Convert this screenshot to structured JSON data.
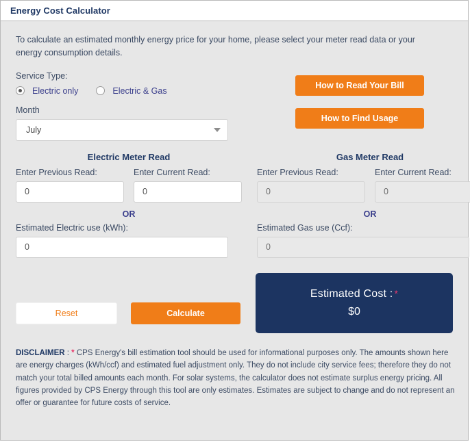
{
  "window": {
    "title": "Energy Cost Calculator"
  },
  "intro": {
    "text": "To calculate an estimated monthly energy price for your home, please select your meter read data or your energy consumption details."
  },
  "service_type": {
    "label": "Service Type:",
    "options": [
      {
        "label": "Electric only",
        "selected": true
      },
      {
        "label": "Electric & Gas",
        "selected": false
      }
    ]
  },
  "month": {
    "label": "Month",
    "value": "July",
    "caret_icon": "chevron-down-icon"
  },
  "help_buttons": {
    "read_bill": "How to Read Your Bill",
    "find_usage": "How to Find Usage"
  },
  "electric_meter": {
    "title": "Electric Meter Read",
    "previous_label": "Enter Previous Read:",
    "previous_value": "0",
    "current_label": "Enter Current Read:",
    "current_value": "0",
    "or": "OR",
    "estimated_label": "Estimated Electric use (kWh):",
    "estimated_value": "0"
  },
  "gas_meter": {
    "title": "Gas Meter Read",
    "previous_label": "Enter Previous Read:",
    "previous_value": "0",
    "current_label": "Enter Current Read:",
    "current_value": "0",
    "or": "OR",
    "estimated_label": "Estimated Gas use (Ccf):",
    "estimated_value": "0"
  },
  "actions": {
    "reset": "Reset",
    "calculate": "Calculate"
  },
  "estimated_cost": {
    "title": "Estimated Cost :",
    "star": "*",
    "value": "$0"
  },
  "disclaimer": {
    "heading": "DISCLAIMER",
    "separator": " : ",
    "star": "*",
    "text": " CPS Energy's bill estimation tool should be used for informational purposes only. The amounts shown here are energy charges (kWh/ccf) and estimated fuel adjustment only. They do not include city service fees; therefore they do not match your total billed amounts each month. For solar systems, the calculator does not estimate surplus energy pricing. All figures provided by CPS Energy through this tool are only estimates. Estimates are subject to change and do not represent an offer or guarantee for future costs of service."
  },
  "colors": {
    "accent_orange": "#f07d18",
    "navy": "#1c3461",
    "heading_navy": "#1f3864",
    "label_blue": "#3b4a63",
    "radio_blue": "#3b3f8c",
    "star_pink": "#e8396b",
    "body_grey": "#e7e7e7"
  }
}
